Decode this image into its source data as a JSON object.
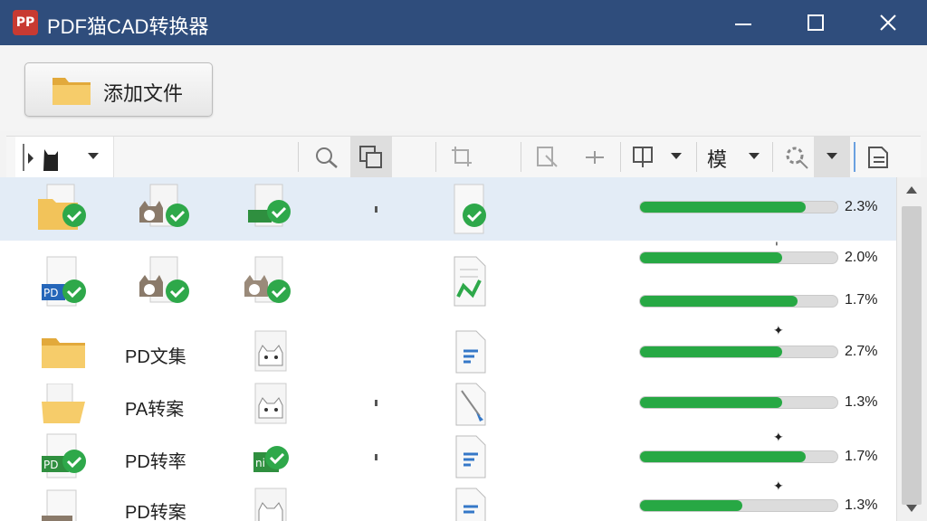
{
  "window": {
    "logo": "PP",
    "title": "PDF猫CAD转换器"
  },
  "ribbon": {
    "add_label": "添加文件"
  },
  "toolbar": {
    "mode_label": "模"
  },
  "rows": [
    {
      "name": "",
      "progress": 0.84,
      "percent": "2.3%",
      "marker": ""
    },
    {
      "name": "",
      "progress": 0.72,
      "percent": "2.0%",
      "marker": "'"
    },
    {
      "name": "",
      "progress": 0.8,
      "percent": "1.7%",
      "marker": ""
    },
    {
      "name": "PD文集",
      "progress": 0.72,
      "percent": "2.7%",
      "marker": "✦"
    },
    {
      "name": "PA转案",
      "progress": 0.72,
      "percent": "1.3%",
      "marker": ""
    },
    {
      "name": "PD转率",
      "progress": 0.84,
      "percent": "1.7%",
      "marker": "✦"
    },
    {
      "name": "PD转案",
      "progress": 0.52,
      "percent": "1.3%",
      "marker": "✦"
    }
  ],
  "colors": {
    "titlebar": "#2f4d7c",
    "progress": "#27a844",
    "check": "#2ea84a",
    "selected_row": "#e3ecf6"
  }
}
